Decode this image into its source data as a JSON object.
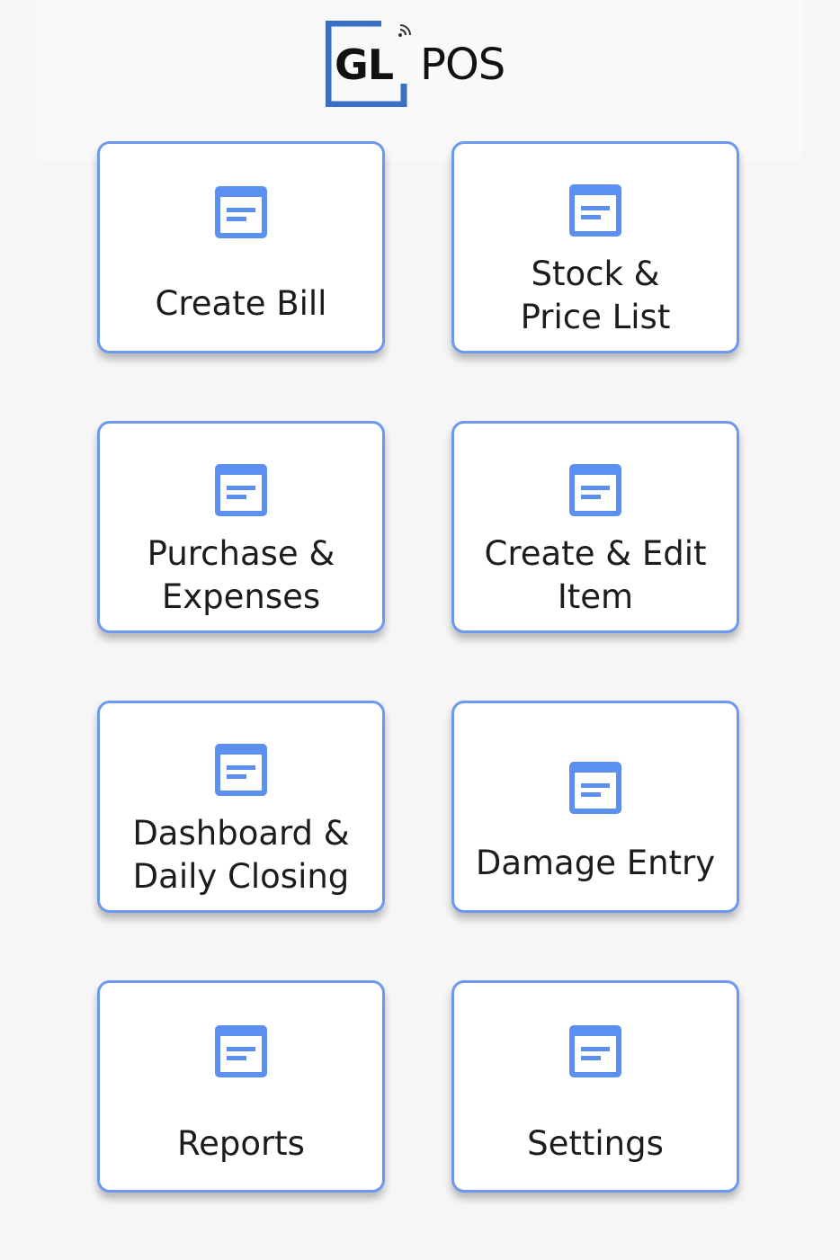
{
  "header": {
    "logo_gl": "GL",
    "logo_pos": "POS"
  },
  "tiles": [
    {
      "label": "Create Bill",
      "icon": "document-icon"
    },
    {
      "label": "Stock &\nPrice List",
      "icon": "document-icon"
    },
    {
      "label": "Purchase &\nExpenses",
      "icon": "document-icon"
    },
    {
      "label": "Create & Edit\nItem",
      "icon": "document-icon"
    },
    {
      "label": "Dashboard &\nDaily Closing",
      "icon": "document-icon"
    },
    {
      "label": "Damage Entry",
      "icon": "document-icon"
    },
    {
      "label": "Reports",
      "icon": "document-icon"
    },
    {
      "label": "Settings",
      "icon": "document-icon"
    }
  ],
  "colors": {
    "accent": "#5b8ff0",
    "tile_border": "#6d98f0",
    "background": "#f6f6f6",
    "logo_blue": "#3a6fc6",
    "text": "#1c1c1c"
  }
}
